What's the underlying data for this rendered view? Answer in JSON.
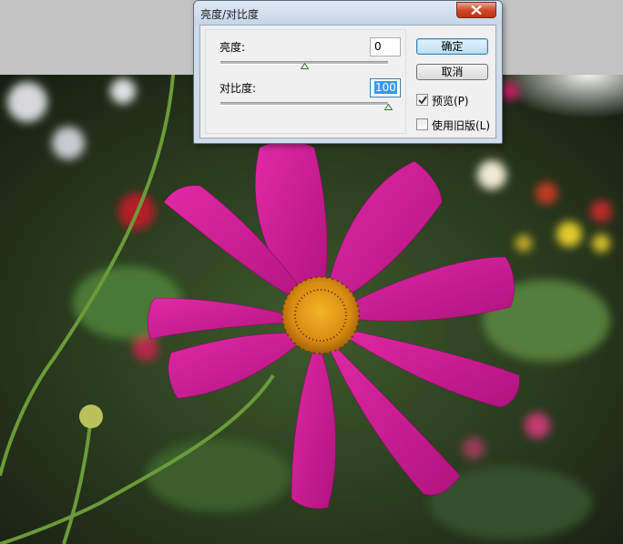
{
  "dialog": {
    "title": "亮度/对比度",
    "brightness_label": "亮度:",
    "brightness_value": "0",
    "brightness_level": 0.5,
    "contrast_label": "对比度:",
    "contrast_value": "100",
    "contrast_level": 1.0,
    "ok_label": "确定",
    "cancel_label": "取消",
    "preview_label": "预览(P)",
    "preview_checked": true,
    "legacy_label": "使用旧版(L)",
    "legacy_checked": false
  },
  "icons": {
    "close": "close-icon",
    "check": "check-icon",
    "slider_thumb": "triangle-up-icon"
  },
  "colors": {
    "accent": "#3399ff",
    "petal": "#c8188f",
    "flower_center": "#e8a21a",
    "close_button": "#cf4a2b"
  }
}
